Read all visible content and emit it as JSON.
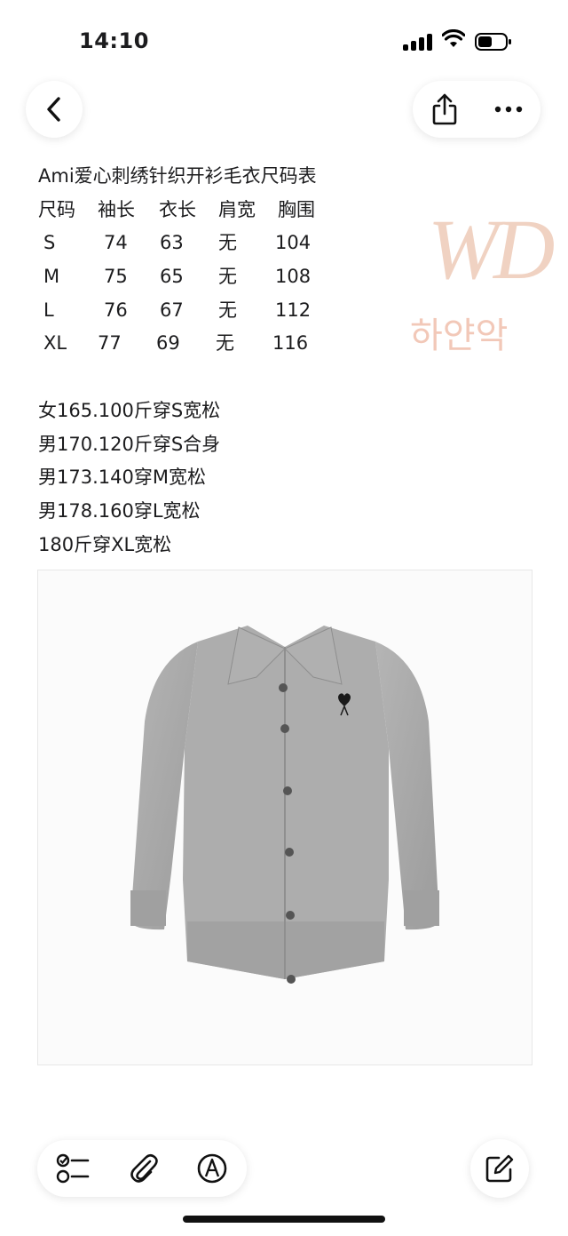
{
  "status_bar": {
    "time": "14:10"
  },
  "toolbar": {
    "back": "back",
    "share": "share",
    "more": "more"
  },
  "note": {
    "title": "Ami爱心刺绣针织开衫毛衣尺码表",
    "size_table": {
      "headers": [
        "尺码",
        "袖长",
        "衣长",
        "肩宽",
        "胸围"
      ],
      "rows": [
        [
          "S",
          "74",
          "63",
          "无",
          "104"
        ],
        [
          "M",
          "75",
          "65",
          "无",
          "108"
        ],
        [
          "L",
          "76",
          "67",
          "无",
          "112"
        ],
        [
          "XL",
          "77",
          "69",
          "无",
          "116"
        ]
      ]
    },
    "recommendations": [
      "女165.100斤穿S宽松",
      "男170.120斤穿S合身",
      "男173.140穿M宽松",
      "男178.160穿L宽松",
      "180斤穿XL宽松"
    ]
  },
  "watermark": {
    "logo": "WD",
    "text": "하얀악"
  },
  "bottom_toolbar": {
    "icons": [
      "checklist-icon",
      "paperclip-icon",
      "markup-icon",
      "compose-icon"
    ]
  },
  "colors": {
    "sweater": "#a7a7a7",
    "accent_watermark": "#f0d2c2"
  }
}
